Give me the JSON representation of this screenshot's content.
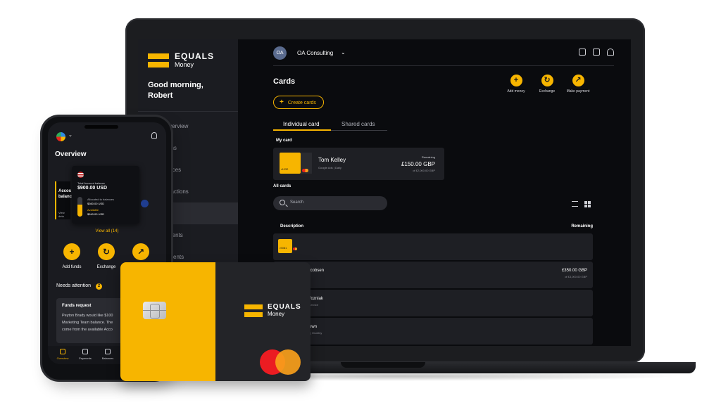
{
  "brand": {
    "name": "EQUALS",
    "sub": "Money",
    "accent": "#f7b500"
  },
  "desktop": {
    "greeting_line1": "Good morning,",
    "greeting_line2": "Robert",
    "nav": [
      {
        "label": "Overview"
      },
      {
        "label": "tions"
      },
      {
        "label": "lances"
      },
      {
        "label": "nsactions"
      },
      {
        "label": "rds"
      },
      {
        "label": "yments"
      },
      {
        "label": "cipients"
      }
    ],
    "org_initials": "OA",
    "org_name": "OA Consulting",
    "page_title": "Cards",
    "quick_actions": [
      {
        "label": "Add money",
        "icon": "plus-icon"
      },
      {
        "label": "Exchange",
        "icon": "exchange-icon"
      },
      {
        "label": "Make payment",
        "icon": "payment-icon"
      }
    ],
    "create_cards": "Create cards",
    "tabs": {
      "individual": "Individual card",
      "shared": "Shared cards"
    },
    "my_card_label": "My card",
    "my_card": {
      "holder": "Tom Kelley",
      "sub": "Google Ads | Daily",
      "last4": "•1032",
      "remaining_label": "Remaining",
      "remaining": "£150.00 GBP",
      "limit": "of £2,000.00 GBP"
    },
    "all_cards_label": "All cards",
    "search_placeholder": "Search",
    "columns": {
      "description": "Description",
      "remaining": "Remaining"
    },
    "rows": [
      {
        "last4": "•9081",
        "name": "",
        "sub": "",
        "amount": "",
        "limit": ""
      },
      {
        "last4": "",
        "name": "el Jacobsen",
        "sub": "rations",
        "amount": "£350.00 GBP",
        "limit": "of £3,000.00 GBP"
      },
      {
        "last4": "",
        "name": "ve Wozniak",
        "sub": "tomer service",
        "amount": "",
        "limit": ""
      },
      {
        "last4": "",
        "name": "n Brown",
        "sub": "search | Monthly",
        "amount": "",
        "limit": ""
      }
    ]
  },
  "mobile": {
    "title": "Overview",
    "account_card": {
      "line1": "Accou",
      "line2": "balanc",
      "view": "View deta"
    },
    "popup": {
      "label": "Total Account balance",
      "value": "$900.00 USD",
      "allocated_label": "Allocated to balances",
      "allocated_value": "$360.00 USD",
      "available_label": "Available",
      "available_value": "$540.00 USD",
      "available_fraction": 0.6
    },
    "view_all": "View all (14)",
    "actions": [
      {
        "label": "Add funds",
        "icon": "plus-icon"
      },
      {
        "label": "Exchange",
        "icon": "exchange-icon"
      },
      {
        "label": "",
        "icon": "payment-icon"
      }
    ],
    "needs_attention": "Needs attention",
    "attention_count": "2",
    "request": {
      "title": "Funds request",
      "line1": "Peyton Brady would like $100",
      "line2": "Marketing Team balance. The",
      "line3": "come from the available Acco"
    },
    "bottom_nav": [
      "Overview",
      "Payments",
      "Balances"
    ]
  },
  "physical_card": {
    "brand": "EQUALS",
    "sub": "Money"
  }
}
